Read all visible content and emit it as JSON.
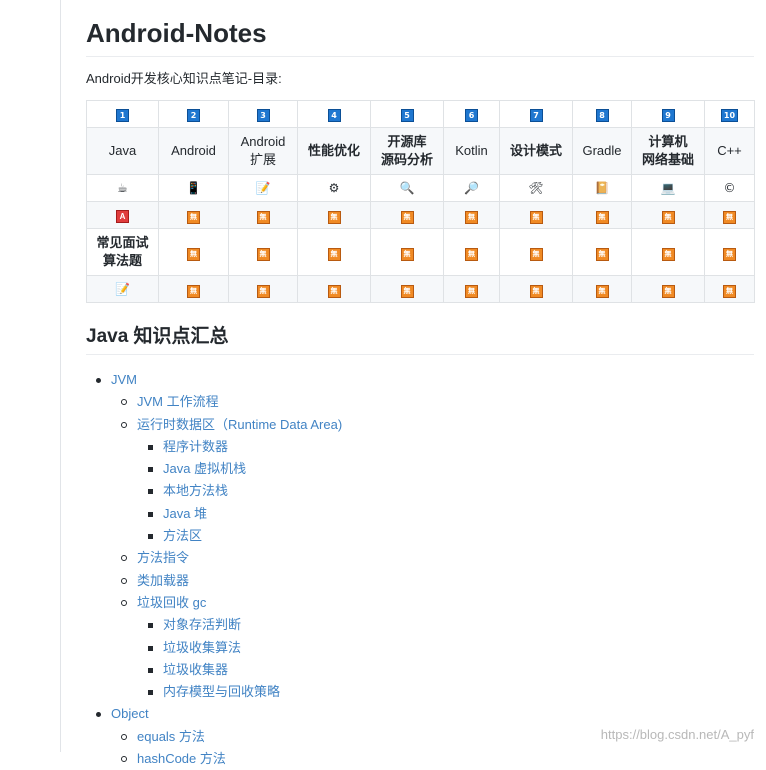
{
  "title": "Android-Notes",
  "intro": "Android开发核心知识点笔记-目录:",
  "table": {
    "numbers": [
      "1",
      "2",
      "3",
      "4",
      "5",
      "6",
      "7",
      "8",
      "9",
      "10"
    ],
    "names": [
      {
        "line1": "Java",
        "line2": "",
        "plain": true
      },
      {
        "line1": "Android",
        "line2": "",
        "plain": true
      },
      {
        "line1": "Android",
        "line2": "扩展",
        "plain": true
      },
      {
        "line1": "性能优化",
        "line2": "",
        "plain": false
      },
      {
        "line1": "开源库",
        "line2": "源码分析",
        "plain": false
      },
      {
        "line1": "Kotlin",
        "line2": "",
        "plain": true
      },
      {
        "line1": "设计模式",
        "line2": "",
        "plain": false
      },
      {
        "line1": "Gradle",
        "line2": "",
        "plain": true
      },
      {
        "line1": "计算机",
        "line2": "网络基础",
        "plain": false
      },
      {
        "line1": "C++",
        "line2": "",
        "plain": true
      }
    ],
    "icons": [
      "☕",
      "📱",
      "📝",
      "⚙",
      "🔍",
      "🔎",
      "🛠",
      "📔",
      "💻",
      "©"
    ],
    "icon_names": [
      "coffee-icon",
      "phone-icon",
      "memo-icon",
      "gear-icon",
      "magnifier-icon",
      "magnifier-right-icon",
      "tools-icon",
      "notebook-icon",
      "laptop-icon",
      "copyright-icon"
    ],
    "a_label": "A",
    "mu_label": "無",
    "algo_line1": "常见面试",
    "algo_line2": "算法题",
    "last_icon": "📝"
  },
  "section_title": "Java 知识点汇总",
  "outline": [
    {
      "level": 1,
      "text": "JVM"
    },
    {
      "level": 2,
      "text": "JVM 工作流程"
    },
    {
      "level": 2,
      "text": "运行时数据区（Runtime Data Area)"
    },
    {
      "level": 3,
      "text": "程序计数器"
    },
    {
      "level": 3,
      "text": "Java 虚拟机栈"
    },
    {
      "level": 3,
      "text": "本地方法栈"
    },
    {
      "level": 3,
      "text": "Java 堆"
    },
    {
      "level": 3,
      "text": "方法区"
    },
    {
      "level": 2,
      "text": "方法指令"
    },
    {
      "level": 2,
      "text": "类加载器"
    },
    {
      "level": 2,
      "text": "垃圾回收 gc"
    },
    {
      "level": 3,
      "text": "对象存活判断"
    },
    {
      "level": 3,
      "text": "垃圾收集算法"
    },
    {
      "level": 3,
      "text": "垃圾收集器"
    },
    {
      "level": 3,
      "text": "内存模型与回收策略"
    },
    {
      "level": 1,
      "text": "Object"
    },
    {
      "level": 2,
      "text": "equals 方法"
    },
    {
      "level": 2,
      "text": "hashCode 方法"
    }
  ],
  "watermark": "https://blog.csdn.net/A_pyf"
}
